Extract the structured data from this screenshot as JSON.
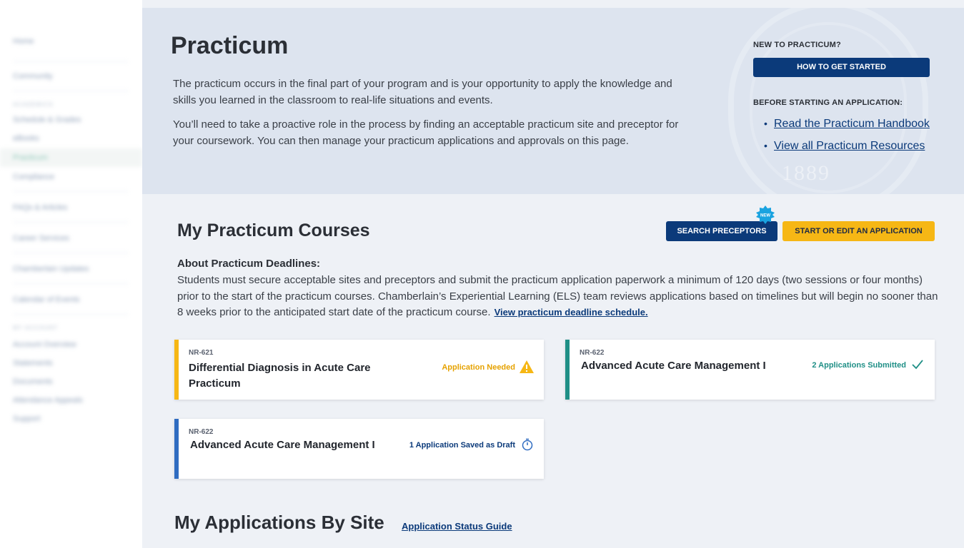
{
  "sidebar": {
    "items_top": [
      "Home",
      "Community"
    ],
    "section_academics": "ACADEMICS",
    "academics": [
      "Schedule & Grades",
      "eBooks",
      "Practicum",
      "Compliance"
    ],
    "middle": [
      "FAQs & Articles",
      "Career Services",
      "Chamberlain Updates",
      "Calendar of Events"
    ],
    "section_account": "MY ACCOUNT",
    "account": [
      "Account Overview",
      "Statements",
      "Documents",
      "Attendance Appeals",
      "Support"
    ]
  },
  "hero": {
    "title": "Practicum",
    "paragraph1": "The practicum occurs in the final part of your program and is your opportunity to apply the knowledge and skills you learned in the classroom to real-life situations and events.",
    "paragraph2": "You’ll need to take a proactive role in the process by finding an acceptable practicum site and preceptor for your coursework. You can then manage your practicum applications and approvals on this page.",
    "new_heading": "NEW TO PRACTICUM?",
    "get_started_label": "HOW TO GET STARTED",
    "before_heading": "BEFORE STARTING AN APPLICATION:",
    "resources": [
      "Read the Practicum Handbook",
      "View all Practicum Resources"
    ],
    "watermark_year": "1889"
  },
  "courses": {
    "title": "My Practicum Courses",
    "search_label": "SEARCH PRECEPTORS",
    "new_badge": "NEW",
    "start_label": "START OR EDIT AN APPLICATION",
    "deadline_heading": "About Practicum Deadlines:",
    "deadline_text": "Students must secure acceptable sites and preceptors and submit the practicum application paperwork a minimum of 120 days (two sessions or four months) prior to the start of the practicum courses. Chamberlain’s Experiential Learning (ELS) team reviews applications based on timelines but will begin no sooner than 8 weeks prior to the anticipated start date of the practicum course.",
    "deadline_link": "View practicum deadline schedule.",
    "cards": [
      {
        "code": "NR-621",
        "title": "Differential Diagnosis in Acute Care Practicum",
        "status": "Application Needed",
        "color": "#f6b715",
        "icon": "warning-icon"
      },
      {
        "code": "NR-622",
        "title": "Advanced Acute Care Management I",
        "status": "2 Applications Submitted",
        "color": "#1f8f86",
        "icon": "check-icon"
      },
      {
        "code": "NR-622",
        "title": "Advanced Acute Care Management I",
        "status": "1 Application Saved as Draft",
        "color": "#2f6cc1",
        "icon": "stopwatch-icon"
      }
    ]
  },
  "applications": {
    "title": "My Applications By Site",
    "guide_link": "Application Status Guide"
  }
}
